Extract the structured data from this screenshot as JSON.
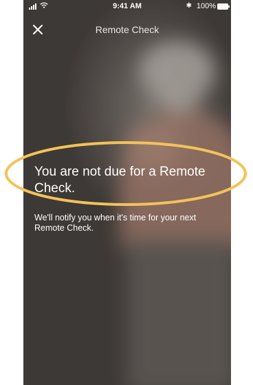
{
  "status_bar": {
    "time": "9:41 AM",
    "battery_percent": "100%",
    "bluetooth_symbol": "✱"
  },
  "header": {
    "title": "Remote Check",
    "close_icon": "close-icon"
  },
  "message": {
    "headline": "You are not due for a Remote Check.",
    "body": "We'll notify you when it's time for your next Remote Check."
  },
  "colors": {
    "highlight_ellipse": "#f2c35a",
    "text": "#ffffff",
    "background_dark": "#45403c"
  }
}
